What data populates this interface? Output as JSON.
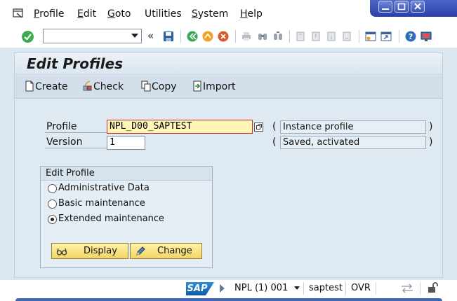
{
  "menubar": {
    "items": [
      {
        "label": "Profile",
        "key": "P",
        "rest": "rofile"
      },
      {
        "label": "Edit",
        "key": "E",
        "rest": "dit"
      },
      {
        "label": "Goto",
        "key": "G",
        "rest": "oto"
      },
      {
        "label": "Utilities",
        "key": "",
        "rest": "Utilities"
      },
      {
        "label": "System",
        "key": "S",
        "rest": "ystem"
      },
      {
        "label": "Help",
        "key": "H",
        "rest": "elp"
      }
    ]
  },
  "toolbar": {
    "command_value": "",
    "back_glyph": "«"
  },
  "page": {
    "title": "Edit Profiles"
  },
  "app_toolbar": {
    "create_label": "Create",
    "check_label": "Check",
    "copy_label": "Copy",
    "import_label": "Import"
  },
  "form": {
    "profile_label": "Profile",
    "profile_value": "NPL_D00_SAPTEST",
    "version_label": "Version",
    "version_value": "1",
    "open_paren": "(",
    "close_paren": ")",
    "profile_desc": "Instance profile",
    "version_desc": "Saved, activated"
  },
  "edit_profile": {
    "title": "Edit Profile",
    "options": [
      {
        "label": "Administrative Data",
        "checked": false
      },
      {
        "label": "Basic maintenance",
        "checked": false
      },
      {
        "label": "Extended maintenance",
        "checked": true
      }
    ],
    "display_label": "Display",
    "change_label": "Change"
  },
  "statusbar": {
    "logo": "SAP",
    "system": "NPL (1) 001",
    "host": "saptest",
    "mode": "OVR"
  },
  "colors": {
    "accent": "#2b3fa6",
    "active_field": "#fff5b7",
    "button_yellow": "#f2d663"
  }
}
